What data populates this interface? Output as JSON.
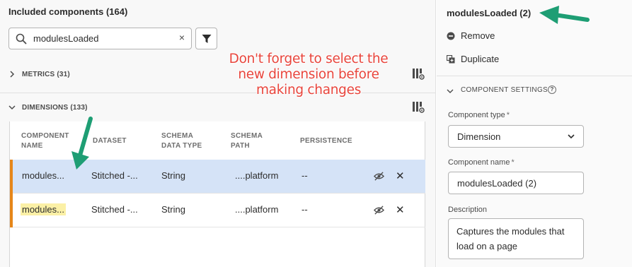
{
  "left_panel": {
    "title": "Included components (164)",
    "search": {
      "value": "modulesLoaded",
      "clear_glyph": "×"
    },
    "sections": {
      "metrics": {
        "label": "METRICS (31)",
        "expanded": false
      },
      "dimensions": {
        "label": "DIMENSIONS (133)",
        "expanded": true
      }
    },
    "table": {
      "headers": {
        "component_name": [
          "COMPONENT",
          "NAME"
        ],
        "dataset": [
          "DATASET"
        ],
        "schema_data_type": [
          "SCHEMA",
          "DATA TYPE"
        ],
        "schema_path": [
          "SCHEMA",
          "PATH"
        ],
        "persistence": [
          "PERSISTENCE"
        ]
      },
      "rows": [
        {
          "name": "modules...",
          "dataset": "Stitched -...",
          "type": "String",
          "path": "....platform",
          "persistence": "--",
          "selected": true,
          "highlighted": false
        },
        {
          "name": "modules...",
          "dataset": "Stitched -...",
          "type": "String",
          "path": "....platform",
          "persistence": "--",
          "selected": false,
          "highlighted": true
        }
      ],
      "remove_glyph": "✕"
    }
  },
  "right_panel": {
    "title": "modulesLoaded (2)",
    "actions": {
      "remove": "Remove",
      "duplicate": "Duplicate"
    },
    "component_settings_label": "COMPONENT SETTINGS",
    "help_glyph": "?",
    "component_type": {
      "label": "Component type",
      "required": "*",
      "value": "Dimension"
    },
    "component_name": {
      "label": "Component name",
      "required": "*",
      "value": "modulesLoaded (2)"
    },
    "description": {
      "label": "Description",
      "value": "Captures the modules that load on a page"
    }
  },
  "annotation": {
    "line1": "Don't forget to select the",
    "line2": "new dimension before",
    "line3": "making changes",
    "arrow_color": "#1e9e74",
    "text_color": "#e8453c"
  },
  "colors": {
    "selection_row": "#d5e3f7",
    "accent_bar": "#e68619",
    "search_highlight": "#fbf0a6"
  }
}
